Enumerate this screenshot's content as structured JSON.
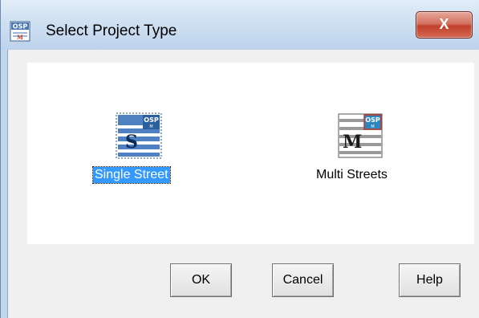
{
  "window": {
    "title": "Select Project Type",
    "app_icon": "osp-app-icon",
    "close_label": "X"
  },
  "options": [
    {
      "label": "Single Street",
      "icon": "single-street-icon",
      "selected": true
    },
    {
      "label": "Multi Streets",
      "icon": "multi-streets-icon",
      "selected": false
    }
  ],
  "buttons": {
    "ok_label": "OK",
    "cancel_label": "Cancel",
    "help_label": "Help"
  },
  "colors": {
    "selection": "#3399ff",
    "close_button": "#c2402c",
    "titlebar": "#cfe0f2"
  }
}
